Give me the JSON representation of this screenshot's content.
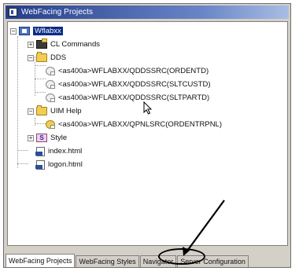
{
  "window": {
    "title": "WebFacing Projects"
  },
  "tree": {
    "root": {
      "label": "Wflabxx"
    },
    "items": [
      {
        "label": "CL Commands"
      },
      {
        "label": "DDS"
      },
      {
        "label": "<as400a>WFLABXX/QDDSSRC(ORDENTD)"
      },
      {
        "label": "<as400a>WFLABXX/QDDSSRC(SLTCUSTD)"
      },
      {
        "label": "<as400a>WFLABXX/QDDSSRC(SLTPARTD)"
      },
      {
        "label": "UIM Help"
      },
      {
        "label": "<as400a>WFLABXX/QPNLSRC(ORDENTRPNL)"
      },
      {
        "label": "Style"
      },
      {
        "label": "index.html"
      },
      {
        "label": "logon.html"
      }
    ]
  },
  "tabs": [
    {
      "label": "WebFacing Projects"
    },
    {
      "label": "WebFacing Styles"
    },
    {
      "label": "Navigator"
    },
    {
      "label": "Server Configuration"
    }
  ],
  "icons": {
    "project": "project-icon",
    "folder": "folder-icon",
    "dds_member": "dds-member-icon",
    "uim_member": "uim-member-icon",
    "style": "style-icon",
    "html": "html-file-icon",
    "cursor": "mouse-cursor-icon"
  }
}
